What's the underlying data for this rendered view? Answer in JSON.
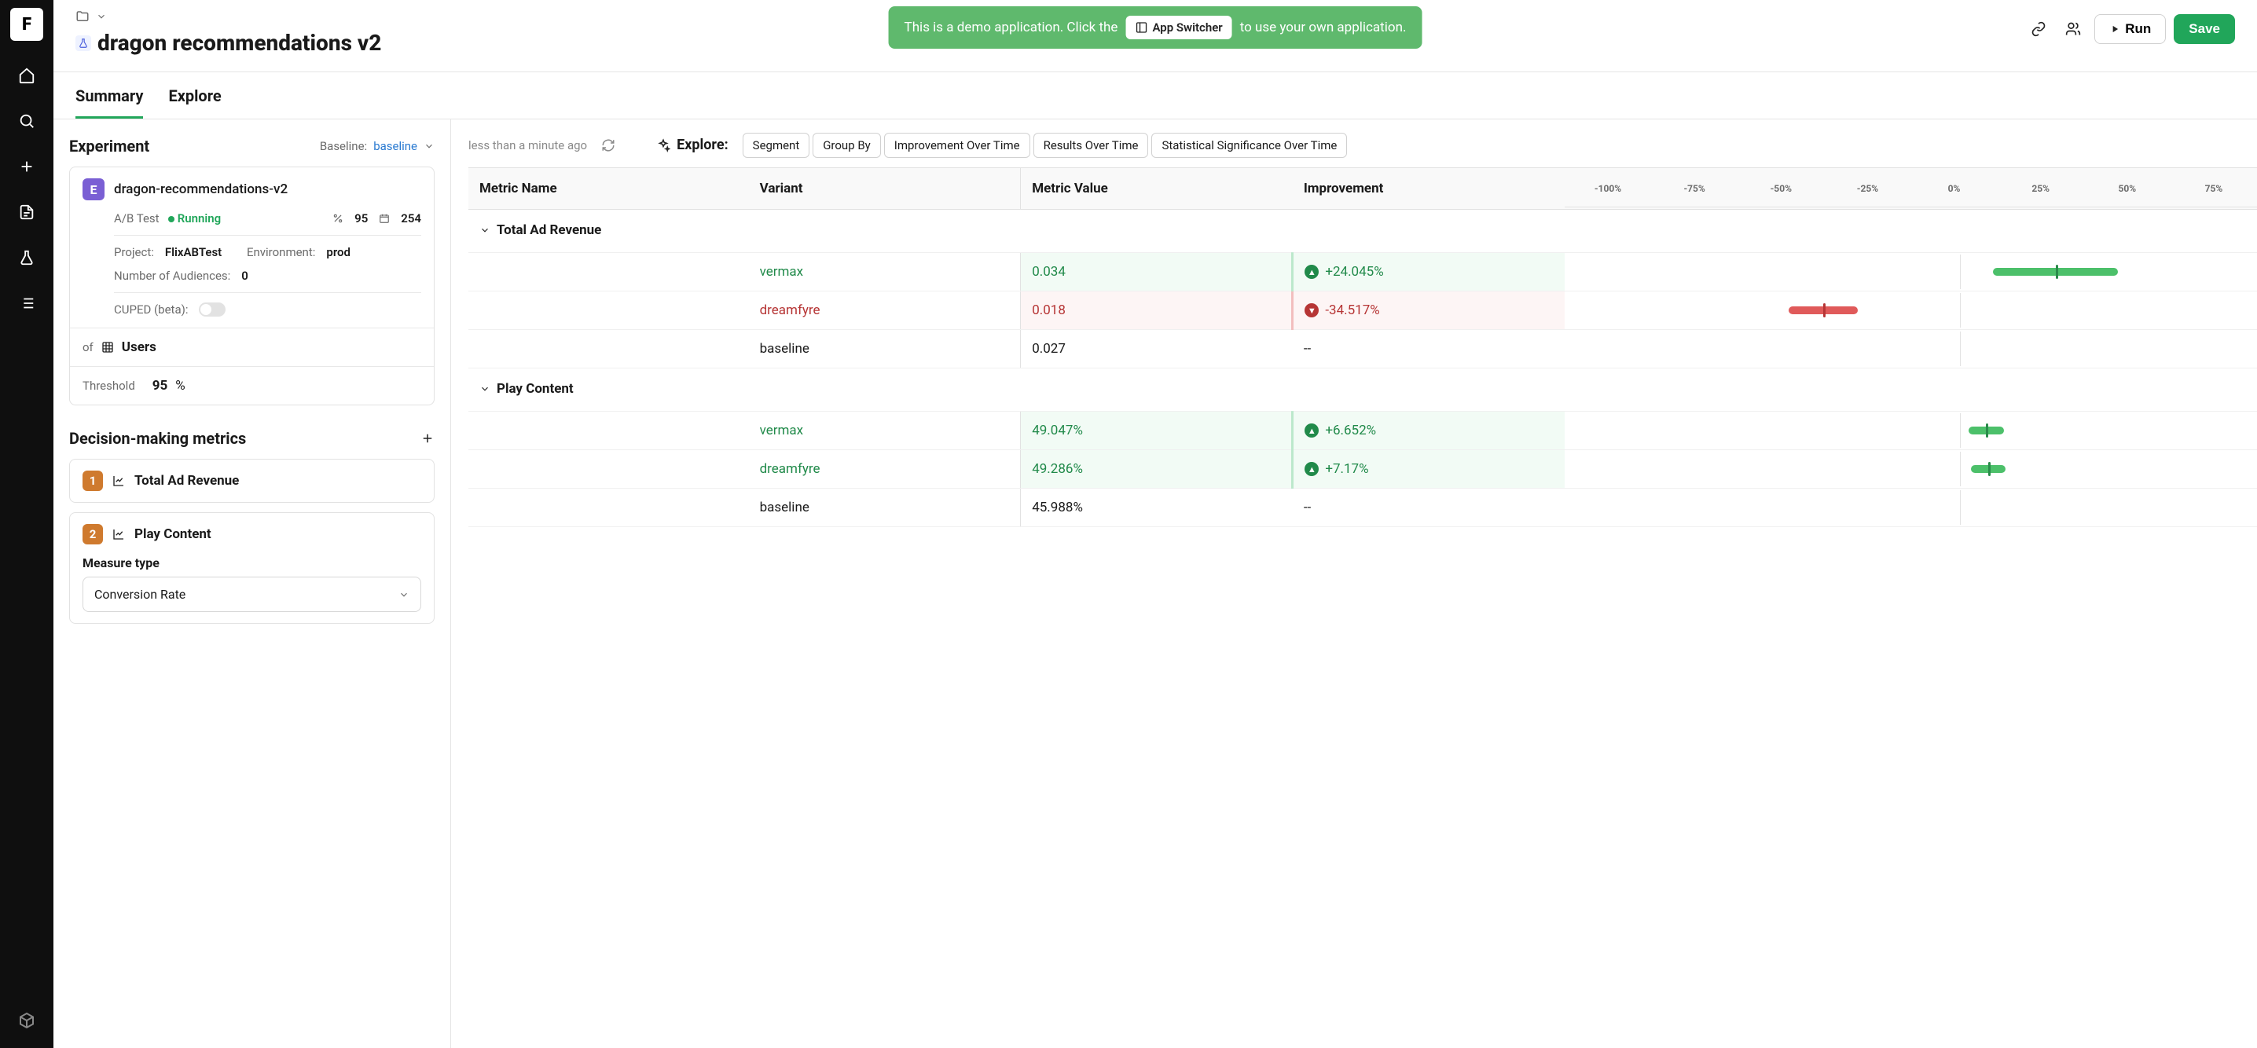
{
  "rail": {
    "logo_letter": "F"
  },
  "topbar": {
    "title": "dragon recommendations v2",
    "demo_pre": "This is a demo application. Click the",
    "demo_post": "to use your own application.",
    "app_switcher": "App Switcher",
    "run": "Run",
    "save": "Save"
  },
  "tabs": {
    "summary": "Summary",
    "explore": "Explore"
  },
  "side": {
    "experiment_title": "Experiment",
    "baseline_label": "Baseline:",
    "baseline_value": "baseline",
    "exp_badge": "E",
    "exp_name": "dragon-recommendations-v2",
    "ab_test": "A/B Test",
    "status": "Running",
    "stat1": "95",
    "stat2": "254",
    "project_label": "Project:",
    "project_value": "FlixABTest",
    "env_label": "Environment:",
    "env_value": "prod",
    "audiences_label": "Number of Audiences:",
    "audiences_value": "0",
    "cuped_label": "CUPED (beta):",
    "of_label": "of",
    "users_label": "Users",
    "threshold_label": "Threshold",
    "threshold_value": "95",
    "threshold_unit": "%",
    "dm_title": "Decision-making metrics",
    "metric1_num": "1",
    "metric1_name": "Total Ad Revenue",
    "metric2_num": "2",
    "metric2_name": "Play Content",
    "measure_type_label": "Measure type",
    "measure_type_value": "Conversion Rate"
  },
  "results": {
    "ago": "less than a minute ago",
    "explore_label": "Explore:",
    "pills": [
      "Segment",
      "Group By",
      "Improvement Over Time",
      "Results Over Time",
      "Statistical Significance Over Time"
    ],
    "headers": {
      "metric": "Metric Name",
      "variant": "Variant",
      "value": "Metric Value",
      "improvement": "Improvement"
    },
    "axis": [
      "-100%",
      "-75%",
      "-50%",
      "-25%",
      "0%",
      "25%",
      "50%",
      "75%"
    ],
    "groups": [
      {
        "name": "Total Ad Revenue",
        "rows": [
          {
            "variant": "vermax",
            "value": "0.034",
            "improvement": "+24.045%",
            "dir": "up",
            "tone": "pos",
            "bar": {
              "center": 70.9,
              "width": 18,
              "tick": 70.9,
              "color": "green"
            }
          },
          {
            "variant": "dreamfyre",
            "value": "0.018",
            "improvement": "-34.517%",
            "dir": "down",
            "tone": "neg",
            "bar": {
              "center": 37.4,
              "width": 10,
              "tick": 37.4,
              "color": "red"
            }
          },
          {
            "variant": "baseline",
            "value": "0.027",
            "improvement": "--",
            "dir": "",
            "tone": "base",
            "bar": null
          }
        ]
      },
      {
        "name": "Play Content",
        "rows": [
          {
            "variant": "vermax",
            "value": "49.047%",
            "improvement": "+6.652%",
            "dir": "up",
            "tone": "pos",
            "bar": {
              "center": 60.9,
              "width": 5,
              "tick": 60.9,
              "color": "green"
            }
          },
          {
            "variant": "dreamfyre",
            "value": "49.286%",
            "improvement": "+7.17%",
            "dir": "up",
            "tone": "pos",
            "bar": {
              "center": 61.2,
              "width": 5,
              "tick": 61.2,
              "color": "green"
            }
          },
          {
            "variant": "baseline",
            "value": "45.988%",
            "improvement": "--",
            "dir": "",
            "tone": "base",
            "bar": null
          }
        ]
      }
    ]
  },
  "chart_data": {
    "type": "bar",
    "title": "Improvement vs baseline",
    "xlabel": "Improvement",
    "xlim": [
      -100,
      75
    ],
    "series": [
      {
        "metric": "Total Ad Revenue",
        "variant": "vermax",
        "improvement_pct": 24.045
      },
      {
        "metric": "Total Ad Revenue",
        "variant": "dreamfyre",
        "improvement_pct": -34.517
      },
      {
        "metric": "Play Content",
        "variant": "vermax",
        "improvement_pct": 6.652
      },
      {
        "metric": "Play Content",
        "variant": "dreamfyre",
        "improvement_pct": 7.17
      }
    ]
  }
}
